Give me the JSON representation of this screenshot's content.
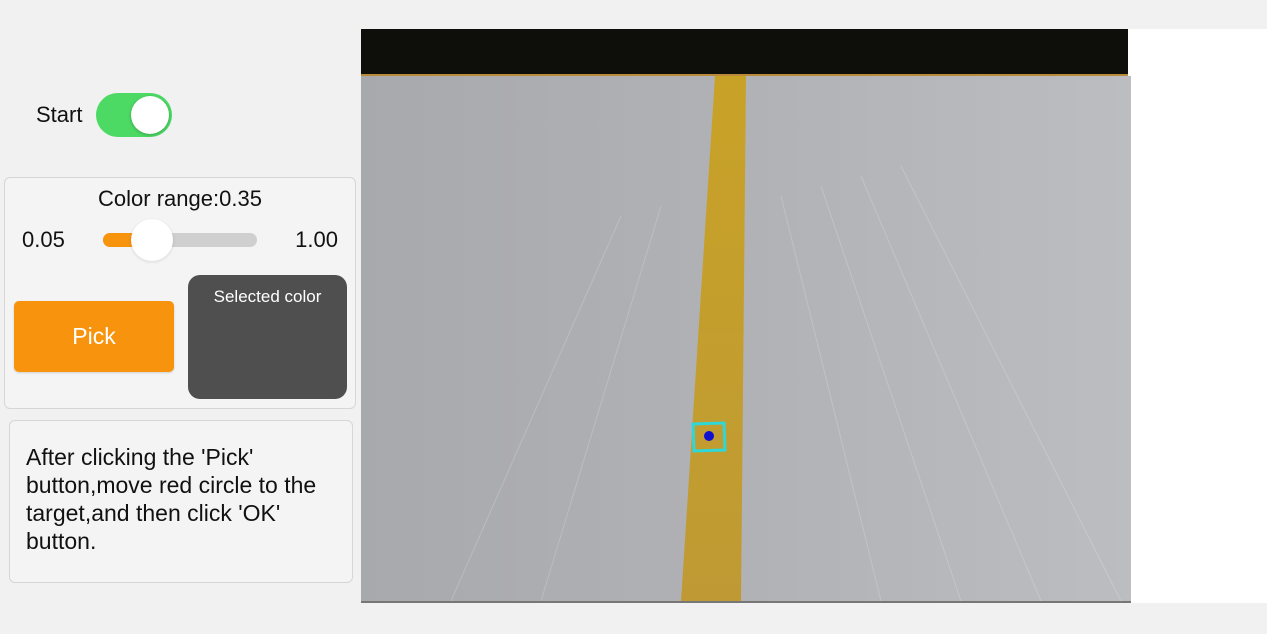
{
  "start": {
    "label": "Start",
    "enabled": true
  },
  "color_range": {
    "title": "Color range:0.35",
    "min_label": "0.05",
    "max_label": "1.00",
    "value": 0.35,
    "min": 0.05,
    "max": 1.0,
    "fill_color": "#f7930c"
  },
  "pick_button": {
    "label": "Pick",
    "color": "#f7930c"
  },
  "selected_color": {
    "label": "Selected color",
    "swatch": "#4f4f4f"
  },
  "instructions": {
    "text": "After clicking the 'Pick' button,move red circle to the target,and then click 'OK' button."
  },
  "camera": {
    "tape_color": "#c9a227",
    "marker_border": "#2fd7d7",
    "marker_dot": "#1010d0"
  },
  "colors": {
    "toggle_on": "#4cd964",
    "accent": "#f7930c"
  }
}
